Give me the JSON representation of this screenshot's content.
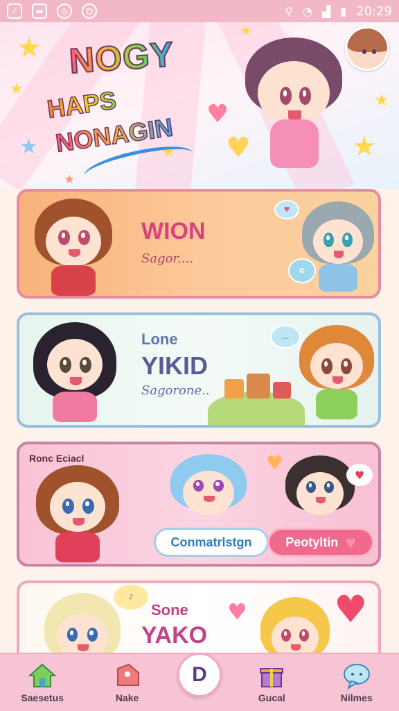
{
  "status_bar": {
    "time": "20:29",
    "icons": [
      "app-icon",
      "photo-icon",
      "target-icon",
      "power-icon",
      "key-icon",
      "wifi-icon",
      "signal-icon",
      "battery-icon"
    ]
  },
  "header": {
    "logo_line1": "NOGY",
    "logo_line2": "HAPS",
    "logo_line3": "NONAGIN",
    "colors": {
      "background": "#fde4ee",
      "accent": "#ff7fa3"
    }
  },
  "cards": [
    {
      "title": "WION",
      "subtitle": "Sagor....",
      "bubbles": [
        "chat-bubble-icon",
        "gift-bubble-icon"
      ],
      "title_color": "#d8437a"
    },
    {
      "title_small": "Lone",
      "title": "YIKID",
      "subtitle": "Sagorone..",
      "bubbles": [
        "chat-bubble-icon"
      ],
      "title_color": "#5a6ab0"
    },
    {
      "label": "Ronc Eciacl",
      "button_left": "Conmatrlstgn",
      "button_right": "Peotyltin",
      "bubbles": [
        "heart-bubble-icon"
      ]
    },
    {
      "title_small": "Sone",
      "title": "YAKO",
      "bubbles": [
        "speech-bubble-icon",
        "heart-icon"
      ],
      "title_color": "#c2428a"
    }
  ],
  "bottom_nav": {
    "items": [
      {
        "label": "Saesetus",
        "icon": "house-icon"
      },
      {
        "label": "Nake",
        "icon": "tag-icon"
      },
      {
        "label": "D",
        "icon": "center-logo-icon"
      },
      {
        "label": "Gucal",
        "icon": "gift-icon"
      },
      {
        "label": "Nilmes",
        "icon": "chat-icon"
      }
    ]
  }
}
